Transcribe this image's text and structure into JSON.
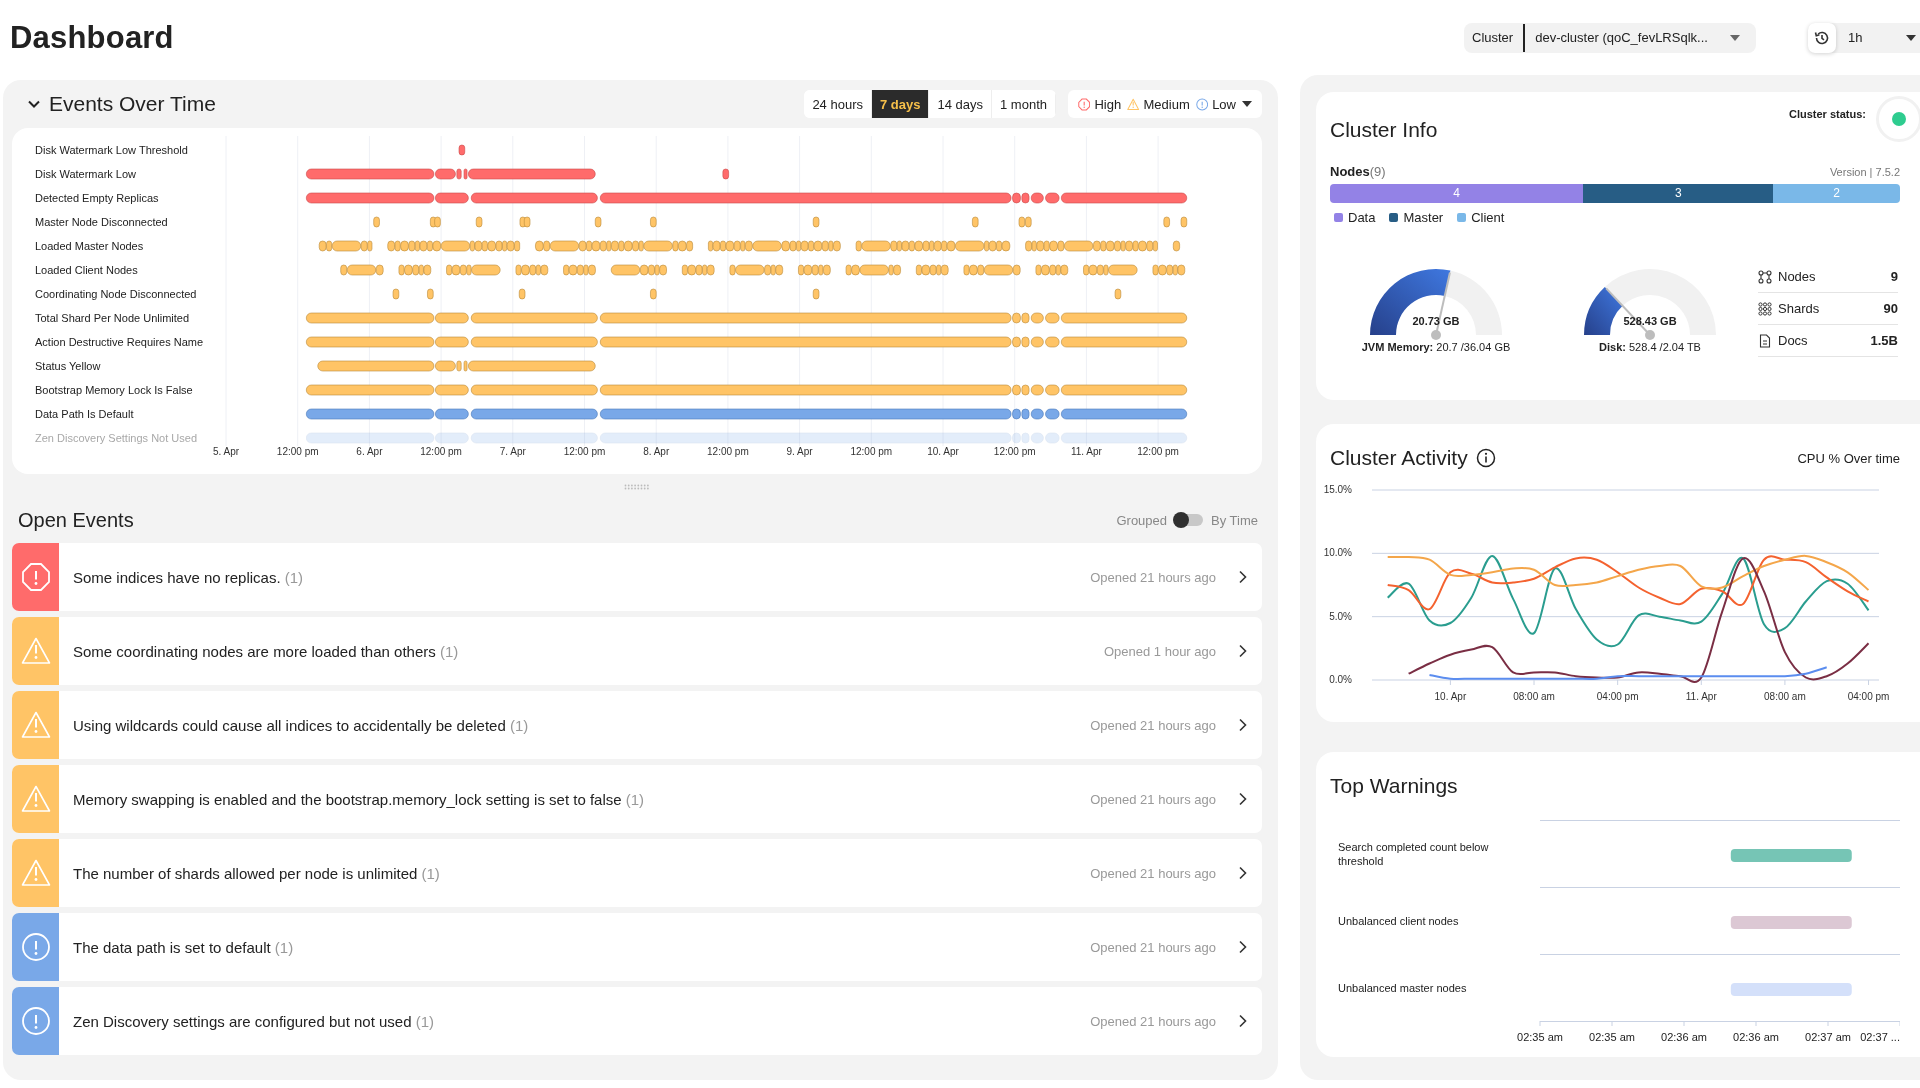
{
  "page_title": "Dashboard",
  "cluster_select": {
    "label": "Cluster",
    "value": "dev-cluster (qoC_fevLRSqlk..."
  },
  "time_select": {
    "value": "1h"
  },
  "events_over_time": {
    "title": "Events Over Time",
    "expanded": true,
    "ranges": [
      {
        "label": "24 hours",
        "selected": false
      },
      {
        "label": "7 days",
        "selected": true
      },
      {
        "label": "14 days",
        "selected": false
      },
      {
        "label": "1 month",
        "selected": false
      }
    ],
    "severity_filter": [
      {
        "kind": "high",
        "label": "High"
      },
      {
        "kind": "medium",
        "label": "Medium"
      },
      {
        "kind": "low",
        "label": "Low"
      }
    ],
    "rows": [
      {
        "label": "Disk Watermark Low Threshold",
        "kind": "high",
        "faded": false
      },
      {
        "label": "Disk Watermark Low",
        "kind": "high",
        "faded": false
      },
      {
        "label": "Detected Empty Replicas",
        "kind": "high",
        "faded": false
      },
      {
        "label": "Master Node Disconnected",
        "kind": "medium",
        "faded": false
      },
      {
        "label": "Loaded Master Nodes",
        "kind": "medium",
        "faded": false
      },
      {
        "label": "Loaded Client Nodes",
        "kind": "medium",
        "faded": false
      },
      {
        "label": "Coordinating Node Disconnected",
        "kind": "medium",
        "faded": false
      },
      {
        "label": "Total Shard Per Node Unlimited",
        "kind": "medium",
        "faded": false
      },
      {
        "label": "Action Destructive Requires Name",
        "kind": "medium",
        "faded": false
      },
      {
        "label": "Status Yellow",
        "kind": "medium",
        "faded": false
      },
      {
        "label": "Bootstrap Memory Lock Is False",
        "kind": "medium",
        "faded": false
      },
      {
        "label": "Data Path Is Default",
        "kind": "low",
        "faded": false
      },
      {
        "label": "Zen Discovery Settings Not Used",
        "kind": "low",
        "faded": true
      }
    ],
    "axis_labels": [
      "5. Apr",
      "12:00 pm",
      "6. Apr",
      "12:00 pm",
      "7. Apr",
      "12:00 pm",
      "8. Apr",
      "12:00 pm",
      "9. Apr",
      "12:00 pm",
      "10. Apr",
      "12:00 pm",
      "11. Apr",
      "12:00 pm"
    ]
  },
  "open_events": {
    "title": "Open Events",
    "toggle": {
      "left": "Grouped",
      "right": "By Time",
      "on": false
    },
    "items": [
      {
        "kind": "high",
        "title": "Some indices have no replicas.",
        "count": "(1)",
        "opened": "Opened 21 hours ago"
      },
      {
        "kind": "medium",
        "title": "Some coordinating nodes are more loaded than others",
        "count": "(1)",
        "opened": "Opened 1 hour ago"
      },
      {
        "kind": "medium",
        "title": "Using wildcards could cause all indices to accidentally be deleted",
        "count": "(1)",
        "opened": "Opened 21 hours ago"
      },
      {
        "kind": "medium",
        "title": "Memory swapping is enabled and the bootstrap.memory_lock setting is set to false",
        "count": "(1)",
        "opened": "Opened 21 hours ago"
      },
      {
        "kind": "medium",
        "title": "The number of shards allowed per node is unlimited",
        "count": "(1)",
        "opened": "Opened 21 hours ago"
      },
      {
        "kind": "low",
        "title": "The data path is set to default",
        "count": "(1)",
        "opened": "Opened 21 hours ago"
      },
      {
        "kind": "low",
        "title": "Zen Discovery settings are configured but not used",
        "count": "(1)",
        "opened": "Opened 21 hours ago"
      }
    ]
  },
  "cluster_info": {
    "title": "Cluster Info",
    "status_label": "Cluster status:",
    "status_ok": true,
    "nodes_label": "Nodes",
    "nodes_count": "(9)",
    "version": "Version | 7.5.2",
    "node_segments": [
      {
        "value": "4",
        "color": "#9382e6",
        "legend": "Data"
      },
      {
        "value": "3",
        "color": "#275d85",
        "legend": "Master"
      },
      {
        "value": "2",
        "color": "#7ab8e8",
        "legend": "Client"
      }
    ],
    "gauges": [
      {
        "reading": "20.73 GB",
        "caption_label": "JVM Memory:",
        "caption_value": "20.7 /36.04 GB",
        "level": 0.57
      },
      {
        "reading": "528.43 GB",
        "caption_label": "Disk:",
        "caption_value": "528.4 /2.04 TB",
        "level": 0.26
      }
    ],
    "stats": [
      {
        "kind": "nodes",
        "label": "Nodes",
        "value": "9"
      },
      {
        "kind": "shards",
        "label": "Shards",
        "value": "90"
      },
      {
        "kind": "docs",
        "label": "Docs",
        "value": "1.5B"
      }
    ]
  },
  "cluster_activity": {
    "title": "Cluster Activity",
    "subtitle": "CPU % Over time",
    "chart_data": {
      "type": "line",
      "categories": [
        null,
        null,
        null,
        "10. Apr",
        null,
        null,
        null,
        "08:00 am",
        null,
        null,
        null,
        "04:00 pm",
        null,
        null,
        null,
        "11. Apr",
        null,
        null,
        null,
        "08:00 am",
        null,
        null,
        null,
        "04:00 pm"
      ],
      "ylim": [
        0,
        15
      ],
      "yticks": [
        {
          "value": 0,
          "label": "0.0%"
        },
        {
          "value": 5,
          "label": "5.0%"
        },
        {
          "value": 10,
          "label": "10.0%"
        },
        {
          "value": 15,
          "label": "15.0%"
        }
      ],
      "series": [
        {
          "color": "#2a9d8f",
          "values": [
            6.5,
            7.6,
            4.7,
            4.5,
            6.5,
            9.8,
            6.4,
            3.7,
            8.8,
            5.6,
            3.2,
            2.8,
            5.1,
            5.0,
            4.7,
            4.6,
            6.8,
            9.6,
            4.4,
            4.1,
            6.2,
            7.8,
            7.6,
            5.5
          ]
        },
        {
          "color": "#f4622f",
          "values": [
            7.5,
            7.1,
            5.6,
            8.5,
            8.4,
            7.7,
            7.7,
            8.0,
            8.9,
            9.6,
            9.5,
            8.5,
            7.3,
            6.5,
            6.0,
            7.2,
            7.0,
            6.0,
            9.5,
            9.5,
            9.3,
            8.1,
            7.0,
            6.2
          ]
        },
        {
          "color": "#f4a64a",
          "values": [
            9.7,
            9.7,
            9.5,
            8.3,
            8.3,
            8.5,
            8.8,
            8.7,
            7.5,
            7.5,
            7.7,
            8.2,
            8.7,
            9.0,
            9.0,
            7.4,
            7.3,
            8.2,
            9.0,
            9.5,
            9.8,
            9.3,
            8.5,
            7.1
          ]
        },
        {
          "color": "#7a2e44",
          "values": [
            null,
            0.5,
            1.3,
            2.0,
            2.4,
            2.6,
            0.6,
            0.6,
            0.6,
            0.3,
            0.2,
            0.2,
            0.6,
            0.5,
            0.3,
            0.2,
            5.4,
            9.6,
            7.0,
            2.2,
            0.2,
            0.3,
            1.3,
            2.9
          ]
        },
        {
          "color": "#5b8def",
          "values": [
            null,
            null,
            0.4,
            0.1,
            0.1,
            0.1,
            0.1,
            0.1,
            0.1,
            0.1,
            0.1,
            0.3,
            0.3,
            0.3,
            0.3,
            0.3,
            0.3,
            0.3,
            0.3,
            0.3,
            0.5,
            1.0,
            null,
            null
          ]
        }
      ]
    }
  },
  "top_warnings": {
    "title": "Top Warnings",
    "items": [
      {
        "label": "Search completed count below threshold",
        "color": "#76c5b5"
      },
      {
        "label": "Unbalanced client nodes",
        "color": "#dcc8d4"
      },
      {
        "label": "Unbalanced master nodes",
        "color": "#d4e0fa"
      }
    ],
    "axis_labels": [
      "02:35 am",
      "02:35 am",
      "02:36 am",
      "02:36 am",
      "02:37 am",
      "02:37 ..."
    ]
  }
}
